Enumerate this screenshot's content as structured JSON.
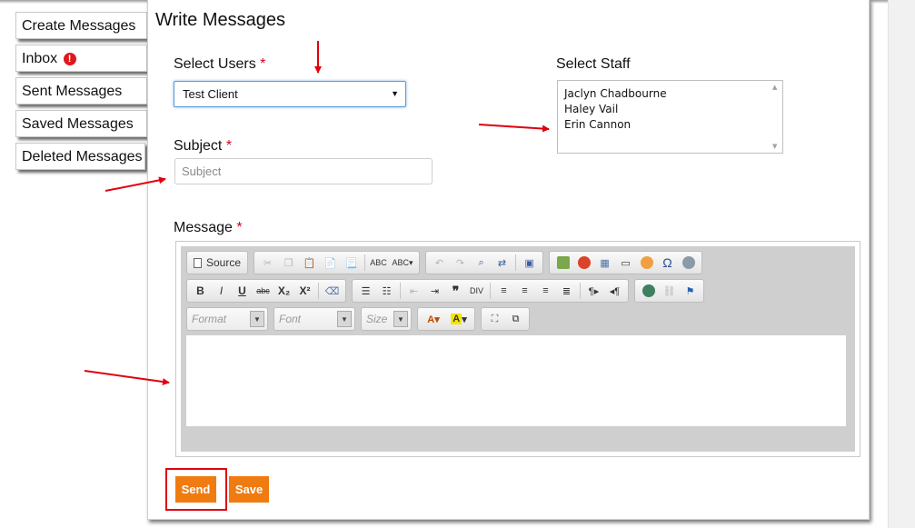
{
  "sidebar": {
    "items": [
      {
        "label": "Create Messages"
      },
      {
        "label": "Inbox",
        "alert": "!"
      },
      {
        "label": "Sent Messages"
      },
      {
        "label": "Saved Messages"
      },
      {
        "label": "Deleted Messages"
      }
    ]
  },
  "main": {
    "title": "Write Messages",
    "required_mark": "*",
    "select_users": {
      "label": "Select Users",
      "value": "Test Client"
    },
    "select_staff": {
      "label": "Select Staff",
      "options": [
        "Jaclyn Chadbourne",
        "Haley Vail",
        "Erin Cannon"
      ]
    },
    "subject": {
      "label": "Subject",
      "placeholder": "Subject"
    },
    "message": {
      "label": "Message"
    }
  },
  "editor": {
    "source_label": "Source",
    "format_placeholder": "Format",
    "font_placeholder": "Font",
    "size_placeholder": "Size",
    "bold": "B",
    "italic": "I",
    "underline": "U",
    "strike": "abc",
    "subscript": "X₂",
    "superscript": "X²"
  },
  "actions": {
    "send_label": "Send",
    "save_label": "Save"
  },
  "colors": {
    "accent": "#f07b10",
    "annotation": "#e0000f"
  }
}
